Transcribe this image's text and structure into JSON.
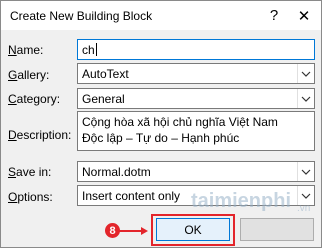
{
  "window": {
    "title": "Create New Building Block",
    "help_glyph": "?",
    "close_glyph": "✕"
  },
  "form": {
    "name": {
      "label": "Name:",
      "value": "ch"
    },
    "gallery": {
      "label": "Gallery:",
      "value": "AutoText"
    },
    "category": {
      "label": "Category:",
      "value": "General"
    },
    "description": {
      "label": "Description:",
      "line1": "Cộng hòa xã hội chủ nghĩa Việt Nam",
      "line2": "Độc lập – Tự do – Hạnh phúc"
    },
    "save_in": {
      "label": "Save in:",
      "value": "Normal.dotm"
    },
    "options": {
      "label": "Options:",
      "value": "Insert content only"
    }
  },
  "buttons": {
    "ok_label": "OK",
    "cancel_label": ""
  },
  "annotation": {
    "step_number": "8",
    "color": "#e3252b"
  },
  "watermark": {
    "text": "taimienphi",
    "suffix": ".vn"
  },
  "icons": {
    "dropdown": "chevron-down-icon",
    "arrow": "arrow-right-icon"
  }
}
